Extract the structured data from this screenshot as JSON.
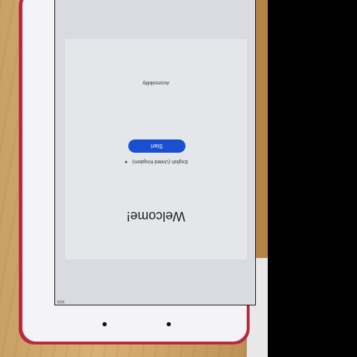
{
  "setup": {
    "title": "Welcome!",
    "language": "English (United Kingdom)",
    "start_label": "Start",
    "accessibility_label": "Accessibility"
  },
  "status_bar": {
    "text": "SOS"
  },
  "icons": {
    "language_dropdown": "chevron-down-icon"
  }
}
